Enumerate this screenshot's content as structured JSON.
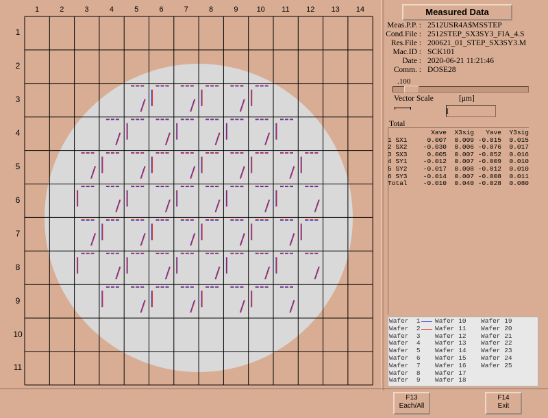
{
  "grid": {
    "columns": [
      "1",
      "2",
      "3",
      "4",
      "5",
      "6",
      "7",
      "8",
      "9",
      "10",
      "11",
      "12",
      "13",
      "14"
    ],
    "rows": [
      "1",
      "2",
      "3",
      "4",
      "5",
      "6",
      "7",
      "8",
      "9",
      "10",
      "11"
    ]
  },
  "colors": {
    "background": "#d8ad94",
    "wafer": "#d9d9d9",
    "vector_blue": "#3333cc",
    "vector_red": "#e03030",
    "legend_bg": "#e8e8e8"
  },
  "panel": {
    "title": "Measured Data",
    "meta": [
      {
        "key": "Meas.P.P. :",
        "value": "2512USR4A$MSSTEP"
      },
      {
        "key": "Cond.File :",
        "value": "2512STEP_SX3SY3_FIA_4.S"
      },
      {
        "key": "Res.File :",
        "value": "200621_01_STEP_SX3SY3.M"
      },
      {
        "key": "Mac.ID :",
        "value": "SCK101"
      },
      {
        "key": "Date :",
        "value": "2020-06-21 11:21:46"
      },
      {
        "key": "Comm. :",
        "value": "DOSE28"
      }
    ],
    "slider_value": ".100",
    "vector_scale_label": "Vector Scale",
    "unit_label": "[μm]",
    "vector_scale_value": "",
    "total_label": "Total",
    "stats": {
      "header": [
        "",
        "Xave",
        "X3sig",
        "Yave",
        "Y3sig"
      ],
      "rows": [
        [
          "1 SX1",
          "0.007",
          "0.009",
          "-0.015",
          "0.015"
        ],
        [
          "2 SX2",
          "-0.030",
          "0.006",
          "-0.076",
          "0.017"
        ],
        [
          "3 SX3",
          "0.005",
          "0.007",
          "-0.052",
          "0.016"
        ],
        [
          "4 SY1",
          "-0.012",
          "0.007",
          "-0.009",
          "0.010"
        ],
        [
          "5 SY2",
          "-0.017",
          "0.008",
          "-0.012",
          "0.010"
        ],
        [
          "6 SY3",
          "-0.014",
          "0.007",
          "-0.008",
          "0.011"
        ],
        [
          "Total",
          "-0.010",
          "0.040",
          "-0.028",
          "0.080"
        ]
      ]
    },
    "legend": [
      "Wafer  1",
      "Wafer  2",
      "Wafer  3",
      "Wafer  4",
      "Wafer  5",
      "Wafer  6",
      "Wafer  7",
      "Wafer  8",
      "Wafer  9",
      "Wafer 10",
      "Wafer 11",
      "Wafer 12",
      "Wafer 13",
      "Wafer 14",
      "Wafer 15",
      "Wafer 16",
      "Wafer 17",
      "Wafer 18",
      "Wafer 19",
      "Wafer 20",
      "Wafer 21",
      "Wafer 22",
      "Wafer 23",
      "Wafer 24",
      "Wafer 25"
    ]
  },
  "fkeys": {
    "f13": {
      "key": "F13",
      "label": "Each/All"
    },
    "f14": {
      "key": "F14",
      "label": "Exit"
    }
  }
}
